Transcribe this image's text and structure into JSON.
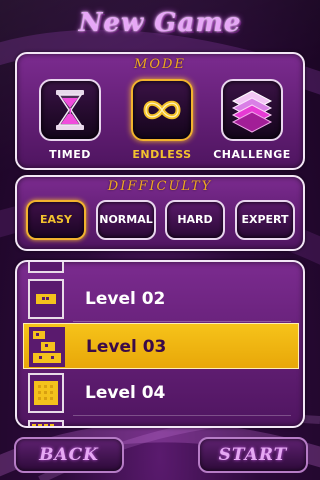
{
  "screen": {
    "title": "New Game"
  },
  "mode_panel": {
    "caption": "MODE",
    "modes": [
      {
        "label": "TIMED",
        "icon": "hourglass-icon"
      },
      {
        "label": "ENDLESS",
        "icon": "infinity-icon"
      },
      {
        "label": "CHALLENGE",
        "icon": "stacked-layers-icon"
      }
    ],
    "selected": "ENDLESS"
  },
  "difficulty_panel": {
    "caption": "DIFFICULTY",
    "options": [
      "EASY",
      "NORMAL",
      "HARD",
      "EXPERT"
    ],
    "selected": "EASY"
  },
  "levels": {
    "items": [
      {
        "name": ""
      },
      {
        "name": "Level 02"
      },
      {
        "name": "Level 03"
      },
      {
        "name": "Level 04"
      }
    ],
    "selected": "Level 03"
  },
  "footer": {
    "back_label": "BACK",
    "start_label": "START"
  },
  "colors": {
    "accent": "#f2b32e",
    "title": "#e7a7f7",
    "panel": "#6a2380",
    "selected_row": "#f2b90f"
  }
}
